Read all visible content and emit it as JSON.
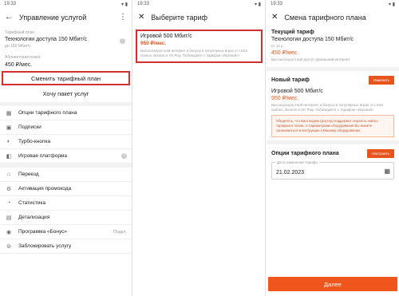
{
  "status": {
    "time": "19:33",
    "icons": "▾ ▮"
  },
  "panel1": {
    "title": "Управление услугой",
    "back_icon": "arrow-left-icon",
    "tariff_label": "Тарифный план",
    "tariff_value": "Технологии доступа 150 Мбит/с",
    "tariff_speed": "до 150 Мбит/с",
    "fee_label": "Абонентская плата",
    "fee_value": "450 ₽/мес.",
    "change_button": "Сменить тарифный план",
    "want_package": "Хочу пакет услуг",
    "menu": [
      {
        "label": "Опции тарифного плана",
        "icon": "grid-icon"
      },
      {
        "label": "Подписки",
        "icon": "subscription-icon"
      },
      {
        "label": "Турбо-кнопка",
        "icon": "turbo-icon"
      },
      {
        "label": "Игровая платформа",
        "icon": "gamepad-icon"
      },
      {
        "label": "Переезд",
        "icon": "move-icon"
      },
      {
        "label": "Активация промокода",
        "icon": "promo-icon"
      },
      {
        "label": "Статистика",
        "icon": "stats-icon"
      },
      {
        "label": "Детализация",
        "icon": "detail-icon"
      },
      {
        "label": "Программа «Бонус»",
        "icon": "bonus-icon",
        "right": "Подкл."
      },
      {
        "label": "Заблокировать услугу",
        "icon": "lock-icon"
      }
    ]
  },
  "panel2": {
    "title": "Выберите тариф",
    "close_icon": "close-icon",
    "tariff_name": "Игровой 500 Мбит/с",
    "tariff_price": "950 ₽/мес.",
    "tariff_desc": "Высокоскоростной интернет и бонусы в популярных играх от Lesta Games, Boomin и VK Play. Побеждайте с тарифом «Игровой»!"
  },
  "panel3": {
    "title": "Смена тарифного плана",
    "current_title": "Текущий тариф",
    "current_value": "Технологии доступа 150 Мбит/с",
    "current_small": "от 15 р.",
    "current_price": "450 ₽/мес.",
    "current_desc": "Высокоскоростной доступ Домашний интернет",
    "new_title": "Новый тариф",
    "change_btn": "Изменить",
    "new_value": "Игровой 500 Мбит/с",
    "new_price": "950 ₽/мес.",
    "new_desc": "Высокоскоростной интернет и бонусы в популярных играх от Lesta Games, Boomin и VK Play. Побеждайте с тарифом «Игровой»",
    "warning": "Убедитесь, что Ваш модем (роутер) поддержит скорость нового тарифного плана. С параметрами оборудования Вы можете ознакомиться в инструкции к Вашему оборудованию",
    "options_title": "Опции тарифного плана",
    "setup_btn": "Настроить",
    "date_label": "Дата изменения тарифа",
    "date_value": "21.02.2023",
    "next_btn": "Далее"
  }
}
